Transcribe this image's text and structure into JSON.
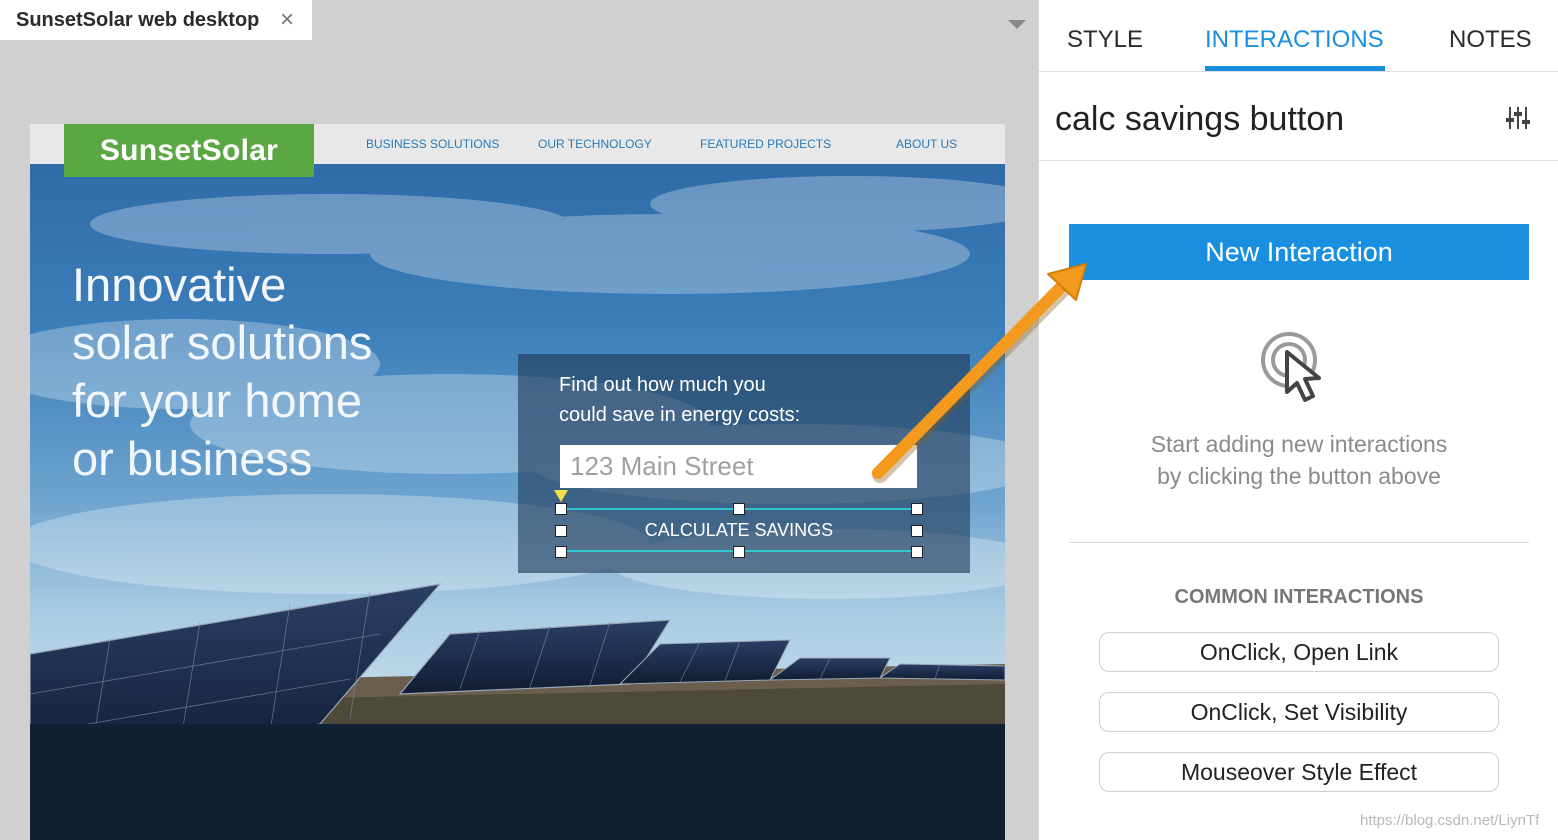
{
  "document_tab": {
    "title": "SunsetSolar web desktop",
    "close_glyph": "×"
  },
  "site": {
    "logo": "SunsetSolar",
    "nav": [
      "BUSINESS SOLUTIONS",
      "OUR TECHNOLOGY",
      "FEATURED PROJECTS",
      "ABOUT US"
    ],
    "headline": [
      "Innovative",
      "solar solutions",
      "for your home",
      "or business"
    ],
    "calc_prompt": [
      "Find out how much you",
      "could save in energy costs:"
    ],
    "address_placeholder": "123 Main Street",
    "calc_button_label": "CALCULATE SAVINGS"
  },
  "panel": {
    "tabs": [
      "STYLE",
      "INTERACTIONS",
      "NOTES"
    ],
    "active_tab": "INTERACTIONS",
    "element_name": "calc savings button",
    "new_interaction_label": "New Interaction",
    "empty_hint": [
      "Start adding new interactions",
      "by clicking the button above"
    ],
    "common_heading": "COMMON INTERACTIONS",
    "common_interactions": [
      "OnClick, Open Link",
      "OnClick, Set Visibility",
      "Mouseover Style Effect"
    ]
  },
  "colors": {
    "accent": "#1a8fe0",
    "logo_green": "#5aa744",
    "selection_cyan": "#2fc6d2",
    "arrow_orange": "#f39a1e"
  },
  "icons": [
    "close-icon",
    "dropdown-icon",
    "settings-sliders-icon",
    "touch-pointer-icon"
  ],
  "watermark": "https://blog.csdn.net/LiynTf"
}
